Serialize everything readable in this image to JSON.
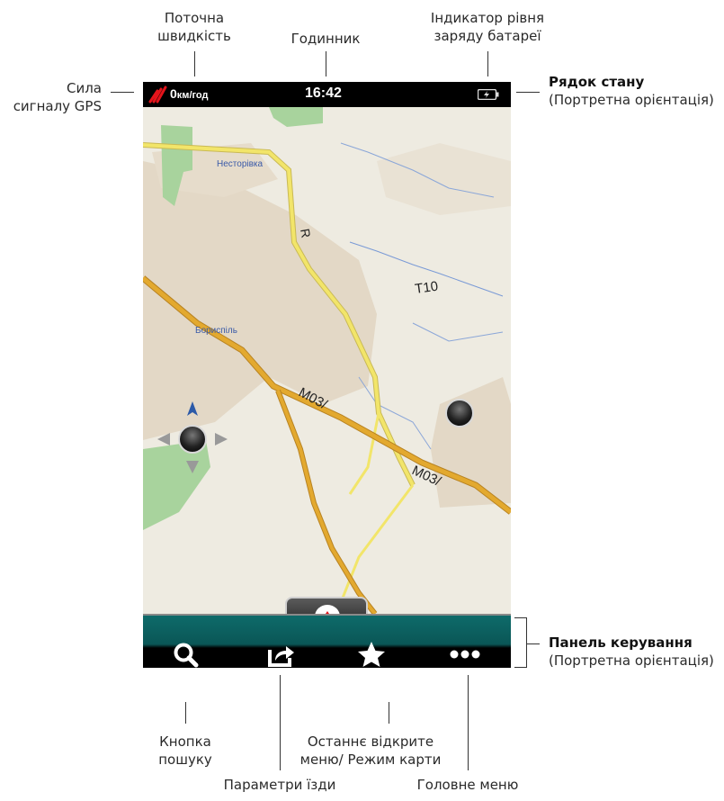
{
  "callouts": {
    "gps_signal": "Сила\nсигналу GPS",
    "current_speed": "Поточна\nшвидкість",
    "clock": "Годинник",
    "battery": "Індикатор рівня\nзаряду батареї",
    "status_bar_title": "Рядок стану",
    "status_bar_sub": "(Портретна орієнтація)",
    "control_panel_title": "Панель керування",
    "control_panel_sub": "(Портретна орієнтація)",
    "search_button": "Кнопка\nпошуку",
    "drive_params": "Параметри їзди",
    "last_menu": "Останнє відкрите\nменю/ Режим карти",
    "main_menu": "Головне меню"
  },
  "statusbar": {
    "speed_value": "0",
    "speed_unit": "км/год",
    "time": "16:42",
    "gps_icon": "gps-signal-icon",
    "battery_icon": "battery-icon"
  },
  "map": {
    "labels": {
      "town_1": "Несторівка",
      "town_2": "Бориспіль",
      "road_r": "R",
      "road_t10": "T10",
      "road_m03_a": "M03/",
      "road_m03_b": "M03/"
    },
    "colors": {
      "background": "#eeebe1",
      "urban": "#e3d8c6",
      "green": "#a8d39d",
      "major_road": "#e3a92f",
      "secondary_road": "#f2e56a",
      "water": "#7a9ad6"
    }
  },
  "controlbar": {
    "buttons": [
      "search-icon",
      "share-icon",
      "star-icon",
      "more-icon"
    ]
  }
}
